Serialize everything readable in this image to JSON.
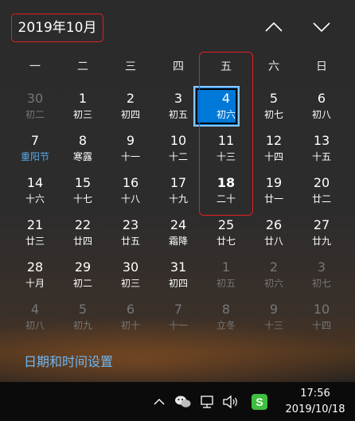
{
  "header": {
    "month_title": "2019年10月"
  },
  "weekdays": [
    "一",
    "二",
    "三",
    "四",
    "五",
    "六",
    "日"
  ],
  "days": [
    {
      "d": "30",
      "l": "初二",
      "state": "dim"
    },
    {
      "d": "1",
      "l": "初三",
      "state": "normal"
    },
    {
      "d": "2",
      "l": "初四",
      "state": "normal"
    },
    {
      "d": "3",
      "l": "初五",
      "state": "normal"
    },
    {
      "d": "4",
      "l": "初六",
      "state": "normal"
    },
    {
      "d": "5",
      "l": "初七",
      "state": "normal"
    },
    {
      "d": "6",
      "l": "初八",
      "state": "normal"
    },
    {
      "d": "7",
      "l": "重阳节",
      "state": "holiday"
    },
    {
      "d": "8",
      "l": "寒露",
      "state": "normal"
    },
    {
      "d": "9",
      "l": "十一",
      "state": "normal"
    },
    {
      "d": "10",
      "l": "十二",
      "state": "normal"
    },
    {
      "d": "11",
      "l": "十三",
      "state": "normal"
    },
    {
      "d": "12",
      "l": "十四",
      "state": "normal"
    },
    {
      "d": "13",
      "l": "十五",
      "state": "normal"
    },
    {
      "d": "14",
      "l": "十六",
      "state": "normal"
    },
    {
      "d": "15",
      "l": "十七",
      "state": "normal"
    },
    {
      "d": "16",
      "l": "十八",
      "state": "normal"
    },
    {
      "d": "17",
      "l": "十九",
      "state": "normal"
    },
    {
      "d": "18",
      "l": "二十",
      "state": "today"
    },
    {
      "d": "19",
      "l": "廿一",
      "state": "normal"
    },
    {
      "d": "20",
      "l": "廿二",
      "state": "normal"
    },
    {
      "d": "21",
      "l": "廿三",
      "state": "normal"
    },
    {
      "d": "22",
      "l": "廿四",
      "state": "normal"
    },
    {
      "d": "23",
      "l": "廿五",
      "state": "normal"
    },
    {
      "d": "24",
      "l": "霜降",
      "state": "normal"
    },
    {
      "d": "25",
      "l": "廿七",
      "state": "normal"
    },
    {
      "d": "26",
      "l": "廿八",
      "state": "normal"
    },
    {
      "d": "27",
      "l": "廿九",
      "state": "normal"
    },
    {
      "d": "28",
      "l": "十月",
      "state": "normal"
    },
    {
      "d": "29",
      "l": "初二",
      "state": "normal"
    },
    {
      "d": "30",
      "l": "初三",
      "state": "normal"
    },
    {
      "d": "31",
      "l": "初四",
      "state": "normal"
    },
    {
      "d": "1",
      "l": "初五",
      "state": "dim"
    },
    {
      "d": "2",
      "l": "初六",
      "state": "dim"
    },
    {
      "d": "3",
      "l": "初七",
      "state": "dim"
    },
    {
      "d": "4",
      "l": "初八",
      "state": "dim"
    },
    {
      "d": "5",
      "l": "初九",
      "state": "dim"
    },
    {
      "d": "6",
      "l": "初十",
      "state": "dim"
    },
    {
      "d": "7",
      "l": "十一",
      "state": "dim"
    },
    {
      "d": "8",
      "l": "立冬",
      "state": "dim"
    },
    {
      "d": "9",
      "l": "十三",
      "state": "dim"
    },
    {
      "d": "10",
      "l": "十四",
      "state": "dim"
    }
  ],
  "settings_link": "日期和时间设置",
  "taskbar": {
    "time": "17:56",
    "date": "2019/10/18"
  },
  "icons": {
    "prev": "chevron-up-icon",
    "next": "chevron-down-icon",
    "tray_expand": "chevron-up-icon",
    "wechat": "wechat-icon",
    "network": "network-icon",
    "volume": "speaker-icon",
    "input_method": "sogou-input-icon"
  },
  "colors": {
    "accent": "#0078d7",
    "link": "#6fb6f0",
    "holiday": "#5aa9e6",
    "highlight_border": "#e02020",
    "dim_text": "#777777",
    "input_method_green": "#3fbf3f"
  }
}
